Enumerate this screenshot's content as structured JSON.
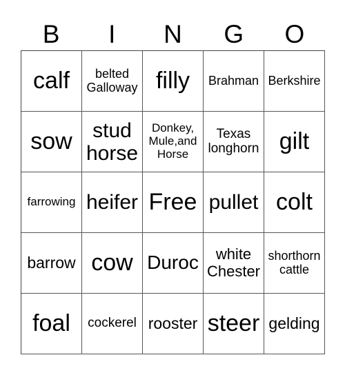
{
  "header": {
    "letters": [
      "B",
      "I",
      "N",
      "G",
      "O"
    ]
  },
  "cells": [
    {
      "text": "calf",
      "size": 34
    },
    {
      "text": "belted Galloway",
      "size": 18
    },
    {
      "text": "filly",
      "size": 34
    },
    {
      "text": "Brahman",
      "size": 18
    },
    {
      "text": "Berkshire",
      "size": 18
    },
    {
      "text": "sow",
      "size": 34
    },
    {
      "text": "stud horse",
      "size": 30
    },
    {
      "text": "Donkey, Mule,and Horse",
      "size": 17
    },
    {
      "text": "Texas longhorn",
      "size": 19
    },
    {
      "text": "gilt",
      "size": 34
    },
    {
      "text": "farrowing",
      "size": 17
    },
    {
      "text": "heifer",
      "size": 30
    },
    {
      "text": "Free",
      "size": 34
    },
    {
      "text": "pullet",
      "size": 30
    },
    {
      "text": "colt",
      "size": 34
    },
    {
      "text": "barrow",
      "size": 23
    },
    {
      "text": "cow",
      "size": 34
    },
    {
      "text": "Duroc",
      "size": 28
    },
    {
      "text": "white Chester",
      "size": 22
    },
    {
      "text": "shorthorn cattle",
      "size": 18
    },
    {
      "text": "foal",
      "size": 34
    },
    {
      "text": "cockerel",
      "size": 19
    },
    {
      "text": "rooster",
      "size": 23
    },
    {
      "text": "steer",
      "size": 34
    },
    {
      "text": "gelding",
      "size": 23
    }
  ]
}
